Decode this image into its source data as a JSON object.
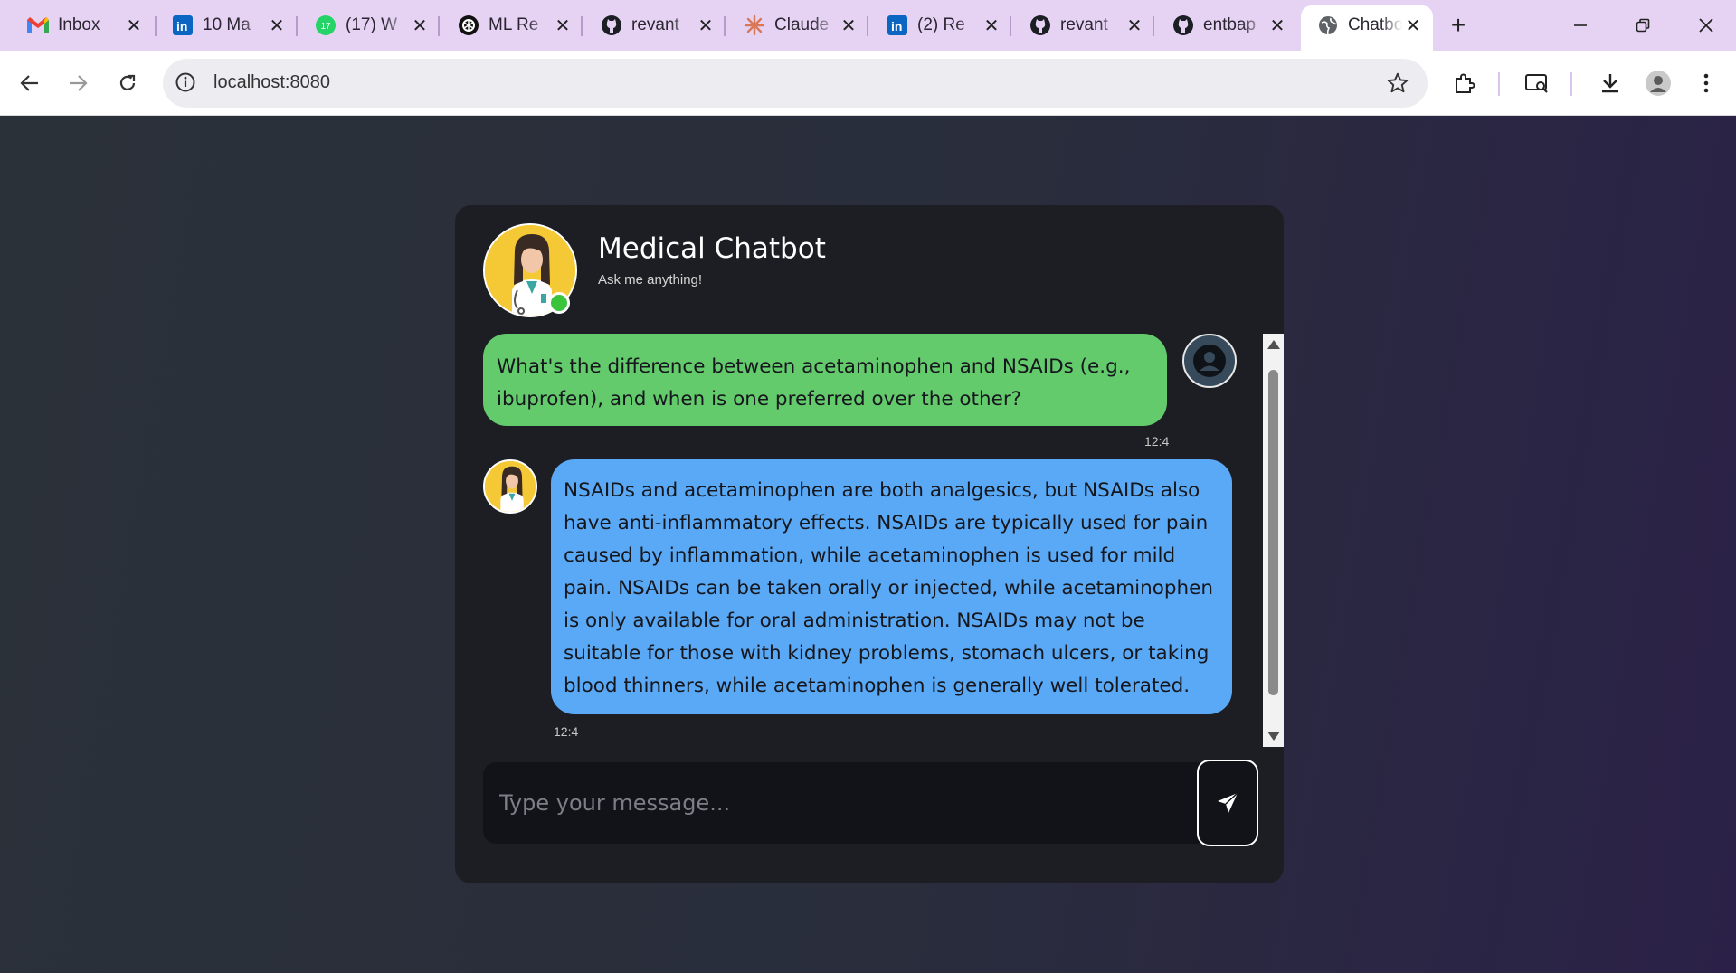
{
  "browser": {
    "tabs": [
      {
        "icon": "gmail-icon",
        "title": "Inbox"
      },
      {
        "icon": "linkedin-icon",
        "title": "10 Ma"
      },
      {
        "icon": "whatsapp-icon",
        "title": "(17) W"
      },
      {
        "icon": "openai-icon",
        "title": "ML Re"
      },
      {
        "icon": "github-icon",
        "title": "revant"
      },
      {
        "icon": "claude-icon",
        "title": "Claude"
      },
      {
        "icon": "linkedin-icon",
        "title": "(2) Re"
      },
      {
        "icon": "github-icon",
        "title": "revant"
      },
      {
        "icon": "github-icon",
        "title": "entbap"
      },
      {
        "icon": "globe-icon",
        "title": "Chatbo"
      }
    ],
    "whatsapp_badge": "17",
    "url": "localhost:8080"
  },
  "chat": {
    "title": "Medical Chatbot",
    "subtitle": "Ask me anything!",
    "messages": [
      {
        "sender": "user",
        "text": "What's the difference between acetaminophen and NSAIDs (e.g., ibuprofen), and when is one preferred over the other?",
        "time": "12:4"
      },
      {
        "sender": "bot",
        "text": "NSAIDs and acetaminophen are both analgesics, but NSAIDs also have anti-inflammatory effects. NSAIDs are typically used for pain caused by inflammation, while acetaminophen is used for mild pain. NSAIDs can be taken orally or injected, while acetaminophen is only available for oral administration. NSAIDs may not be suitable for those with kidney problems, stomach ulcers, or taking blood thinners, while acetaminophen is generally well tolerated.",
        "time": "12:4"
      }
    ],
    "input": {
      "placeholder": "Type your message...",
      "value": ""
    }
  },
  "colors": {
    "user_bubble": "#64cb6d",
    "bot_bubble": "#5aa9f7",
    "card_bg": "#1d1e23",
    "online_status": "#3ac43c",
    "avatar_bg": "#f5c935",
    "tabstrip_bg": "#e6d3f4"
  }
}
